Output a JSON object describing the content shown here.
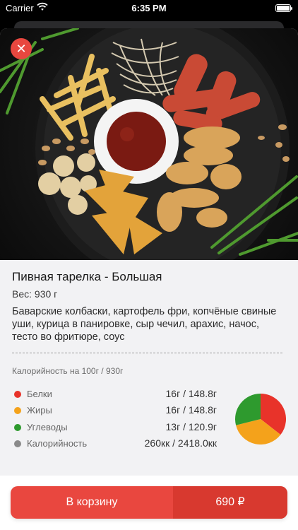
{
  "status_bar": {
    "carrier": "Carrier",
    "time": "6:35 PM"
  },
  "product": {
    "title": "Пивная тарелка - Большая",
    "weight": "Вес: 930 г",
    "description": "Баварские колбаски, картофель фри, копчёные свиные уши, курица в панировке, сыр чечил, арахис, начос, тесто во фритюре, соус",
    "image_icon": "food-platter-image"
  },
  "nutrition": {
    "caption": "Калорийность на 100г / 930г",
    "rows": [
      {
        "label": "Белки",
        "value": "16г / 148.8г",
        "color": "#e8332a"
      },
      {
        "label": "Жиры",
        "value": "16г / 148.8г",
        "color": "#f4a21b"
      },
      {
        "label": "Углеводы",
        "value": "13г / 120.9г",
        "color": "#2e9a2e"
      },
      {
        "label": "Калорийность",
        "value": "260кк / 2418.0кк",
        "color": "#8a8a8a"
      }
    ],
    "pie": [
      {
        "name": "Белки",
        "value": 16,
        "color": "#e8332a"
      },
      {
        "name": "Жиры",
        "value": 16,
        "color": "#f4a21b"
      },
      {
        "name": "Углеводы",
        "value": 13,
        "color": "#2e9a2e"
      }
    ]
  },
  "cart": {
    "button_label": "В корзину",
    "price": "690 ₽",
    "accent": "#e9473f"
  },
  "icons": {
    "close": "close-icon",
    "wifi": "wifi-icon",
    "battery": "battery-icon"
  }
}
